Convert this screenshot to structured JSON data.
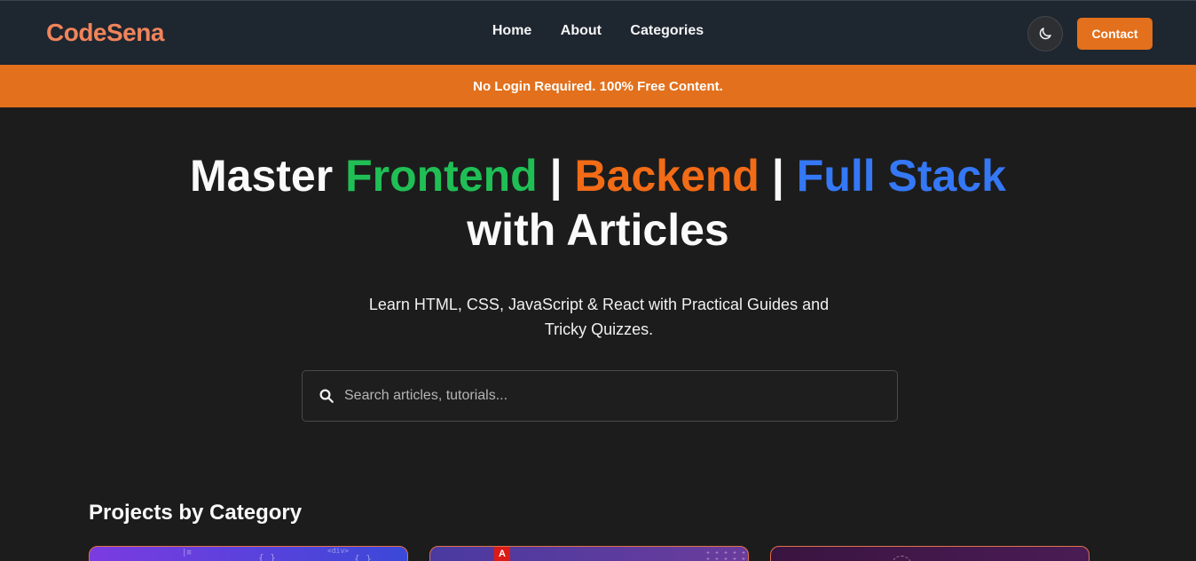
{
  "header": {
    "logo": "CodeSena",
    "nav": [
      "Home",
      "About",
      "Categories"
    ],
    "contact_label": "Contact",
    "theme_toggle_icon": "moon-icon"
  },
  "banner": {
    "text": "No Login Required. 100% Free Content."
  },
  "hero": {
    "title_prefix": "Master",
    "title_frontend": "Frontend",
    "title_sep": "|",
    "title_backend": "Backend",
    "title_fullstack": "Full Stack",
    "title_suffix": "with Articles",
    "subtitle": "Learn HTML, CSS, JavaScript & React with Practical Guides and Tricky Quizzes."
  },
  "search": {
    "placeholder": "Search articles, tutorials...",
    "icon": "search-icon"
  },
  "projects": {
    "title": "Projects by Category",
    "card_decorations": [
      "{ }",
      "<div>",
      "{ }",
      "A"
    ]
  },
  "colors": {
    "accent": "#e2701c",
    "logo": "#f0845a",
    "frontend": "#20bf55",
    "backend": "#f26b16",
    "fullstack": "#3578f6",
    "navbar_bg": "#1e2630",
    "page_bg": "#1c1c1c"
  }
}
